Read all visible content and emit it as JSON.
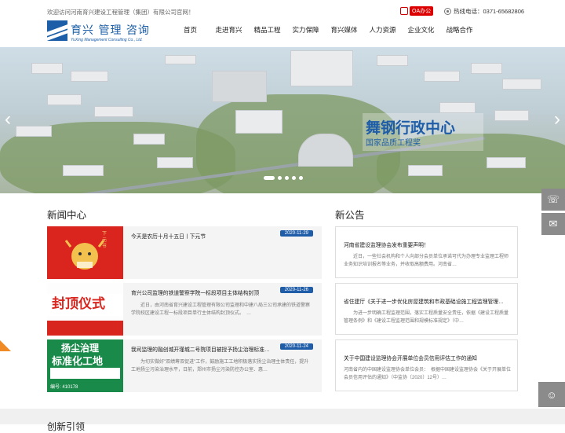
{
  "topbar": {
    "welcome": "欢迎访问河南育兴建设工程管理（集团）有限公司官网！",
    "oa_label": "OA办公",
    "hotline": "热线电话：0371-65682806"
  },
  "logo": {
    "cn": "育兴 管理 咨询",
    "en": "YuXing Management Consulting Co., Ltd."
  },
  "nav": [
    "首页",
    "走进育兴",
    "精品工程",
    "实力保障",
    "育兴媒体",
    "人力资源",
    "企业文化",
    "战略合作"
  ],
  "banner": {
    "title": "舞钢行政中心",
    "subtitle": "国家品质工程奖",
    "prev": "‹",
    "next": "›",
    "slide_count": 5,
    "active_slide": 1
  },
  "news_section": {
    "title": "新闻中心",
    "items": [
      {
        "title": "今天是农历十月十五日丨下元节",
        "date": "2020-11-29",
        "desc": ""
      },
      {
        "title": "育兴公司监理的铁道警察学院一标段项目主体结构封顶",
        "date": "2020-11-26",
        "desc": "　　近日，由河南省育兴建设工程管理有限公司监理和中建八局三公司承建的铁道警察学院校区建设工程一标段项目单行主体结构封顶仪式。　…"
      },
      {
        "title": "我司监理的融创城开瑾城二号院项目被授予扬尘治理标准…",
        "date": "2020-11-24",
        "desc": "　　为切实做好\"双绩筹双促进\"工作，鼓励施工工地积极落实扬尘治理主体责任，提升工地扬尘污染治理水平，日前，郑州市扬尘污染防控办公室、惠…"
      }
    ]
  },
  "notice_section": {
    "title": "新公告",
    "items": [
      {
        "title": "河南省建设监理协会发布重要声明！",
        "desc": "　　近日，一些社会机构和个人向部分会员单位承诺可代为办理专业监理工程师业务知识培训报名等业务，并收取高额费用。河南省…"
      },
      {
        "title": "省住建厅《关于进一步优化房屋建筑和市政基础设施工程监理管理…",
        "desc": "　　为进一步明确工程监理范围，落实工程质量安全责任，依据《建设工程质量管理条例》和《建设工程监理范围和规模标准规定》（中…"
      },
      {
        "title": "关于中国建设监理协会开展单位会员信用评估工作的通知",
        "desc": "河南省内的中国建设监理协会单位会员：　根据中国建设监理协会《关于开展单位会员信用评估的通知》（中监协〔2020〕12号）…"
      }
    ]
  },
  "thumbs": {
    "t1_text": "下元节",
    "t2_text": "封顶仪式",
    "t3_line1": "扬尘治理",
    "t3_line2": "标准化工地",
    "t3_sign": "编号: 410178"
  },
  "side": {
    "chat": "☏",
    "mail": "✉",
    "wechat": "☺"
  },
  "bottom_heading": "创新引领"
}
